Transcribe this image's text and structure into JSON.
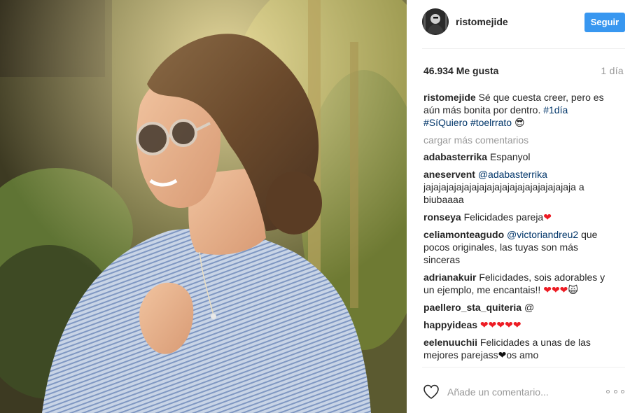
{
  "post": {
    "username": "ristomejide",
    "follow_label": "Seguir",
    "likes": "46.934 Me gusta",
    "time": "1 día"
  },
  "caption": {
    "user": "ristomejide",
    "text": "Sé que cuesta creer, pero es aún más bonita por dentro.",
    "tags": [
      "#1día",
      "#SíQuiero",
      "#toelrrato"
    ],
    "emoji": "😎"
  },
  "load_more": "cargar más comentarios",
  "comments": [
    {
      "user": "adabasterrika",
      "text": "Espanyol"
    },
    {
      "user": "aneservent",
      "mention": "@adabasterrika",
      "text": "jajajajajajajajajajajajajajajajajajajaja a biubaaaa"
    },
    {
      "user": "ronseya",
      "text": "Felicidades pareja",
      "hearts": "❤"
    },
    {
      "user": "celiamonteagudo",
      "mention": "@victoriandreu2",
      "text": "que pocos originales, las tuyas son más sinceras"
    },
    {
      "user": "adrianakuir",
      "text": "Felicidades, sois adorables y un ejemplo, me encantais!!",
      "hearts": "❤❤❤",
      "emoji": "🙀"
    },
    {
      "user": "paellero_sta_quiteria",
      "text": "@"
    },
    {
      "user": "happyideas",
      "hearts": "❤❤❤❤❤"
    },
    {
      "user": "eelenuuchii",
      "text": "Felicidades a unas de las mejores parejass",
      "heart_black": "❤",
      "text2": "os amo"
    }
  ],
  "add_comment_placeholder": "Añade un comentario...",
  "icons": {
    "like": "heart-outline-icon",
    "more": "more-options-icon"
  },
  "colors": {
    "follow_button": "#3897f0",
    "link": "#003569",
    "muted": "#999999",
    "heart": "#ed1c24"
  }
}
